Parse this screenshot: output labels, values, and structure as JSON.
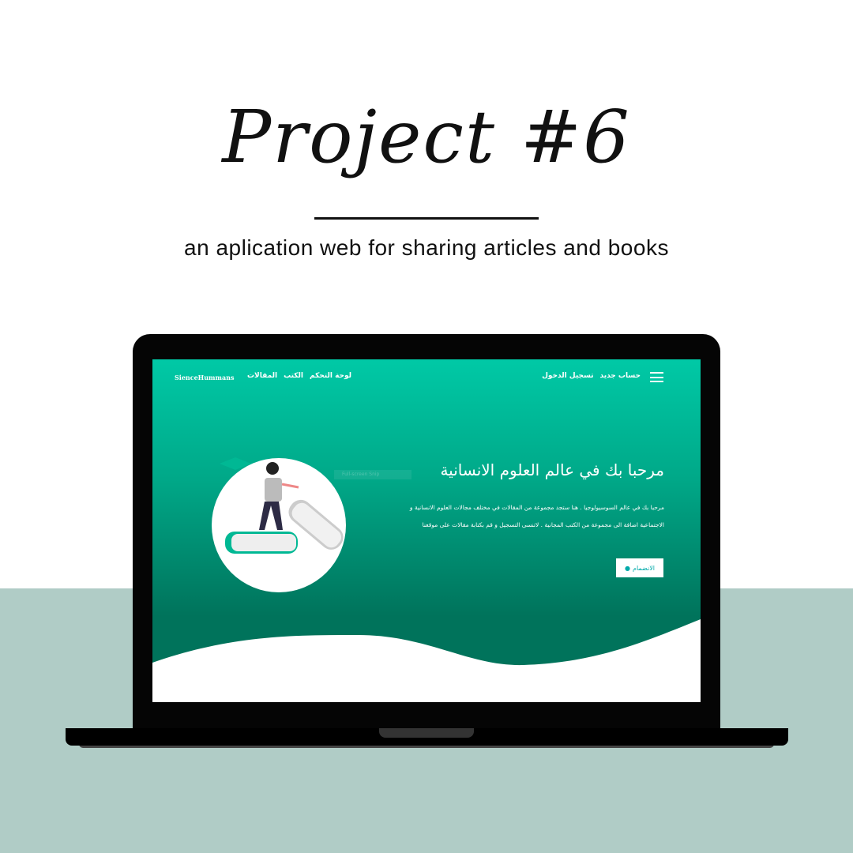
{
  "poster": {
    "title": "Project #6",
    "subtitle": "an aplication web for sharing articles and books"
  },
  "site": {
    "logo": "SienceHummans",
    "nav_links": [
      "لوحة التحكم",
      "الكتب",
      "المقالات"
    ],
    "auth_links": [
      "حساب جديد",
      "تسجيل الدخول"
    ],
    "hero_title": "مرحبا بك في عالم العلوم الانسانية",
    "hero_text": [
      "مرحبا بك في عالم السوسيولوجيا . هنا ستجد مجموعة من المقالات في مختلف مجالات العلوم الانسانية و",
      "الاجتماعية اضافة الى مجموعة من الكتب المجانية . لاتنسى التسجيل و قم بكتابة مقالات على موقعنا"
    ],
    "join_button": "الانضمام",
    "overlay": "Full-screen Snip"
  },
  "colors": {
    "band": "#b0ccc6",
    "accent": "#00c9a6",
    "dark": "#00735b"
  }
}
